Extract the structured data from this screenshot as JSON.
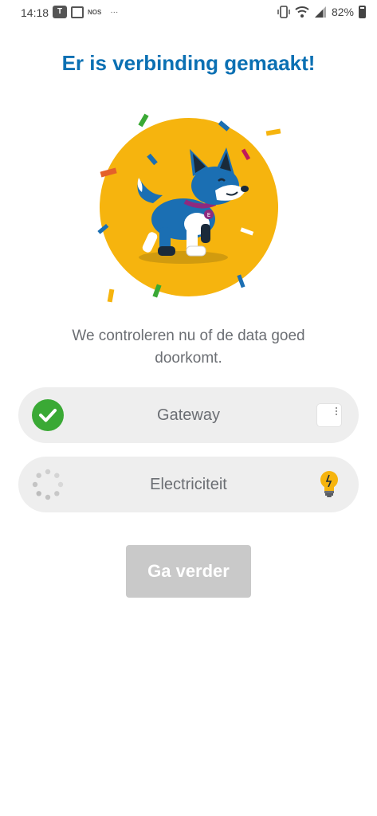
{
  "status_bar": {
    "time": "14:18",
    "left_icons": [
      "teams-icon",
      "calendar-icon",
      "nos-icon"
    ],
    "nos_label": "NOS",
    "more": "···",
    "battery": "82%",
    "right_icons": [
      "vibrate-icon",
      "wifi-icon",
      "signal-icon",
      "battery-icon"
    ]
  },
  "title": "Er is verbinding gemaakt!",
  "illustration": {
    "name": "dog-confetti-illustration",
    "colors": {
      "circle": "#f6b40e",
      "dog": "#1b6fb3"
    }
  },
  "subtitle": "We controleren nu of de data goed doorkomt.",
  "checks": [
    {
      "label": "Gateway",
      "state": "done",
      "left_icon": "check-icon",
      "right_icon": "gateway-device-icon"
    },
    {
      "label": "Electriciteit",
      "state": "loading",
      "left_icon": "spinner-icon",
      "right_icon": "lightbulb-icon"
    }
  ],
  "continue_button": {
    "label": "Ga verder",
    "enabled": false
  },
  "colors": {
    "title": "#0b70b3",
    "success": "#3aa935",
    "row_bg": "#eeeeee",
    "button_disabled": "#c9c9c9",
    "text": "#6b6e73"
  }
}
